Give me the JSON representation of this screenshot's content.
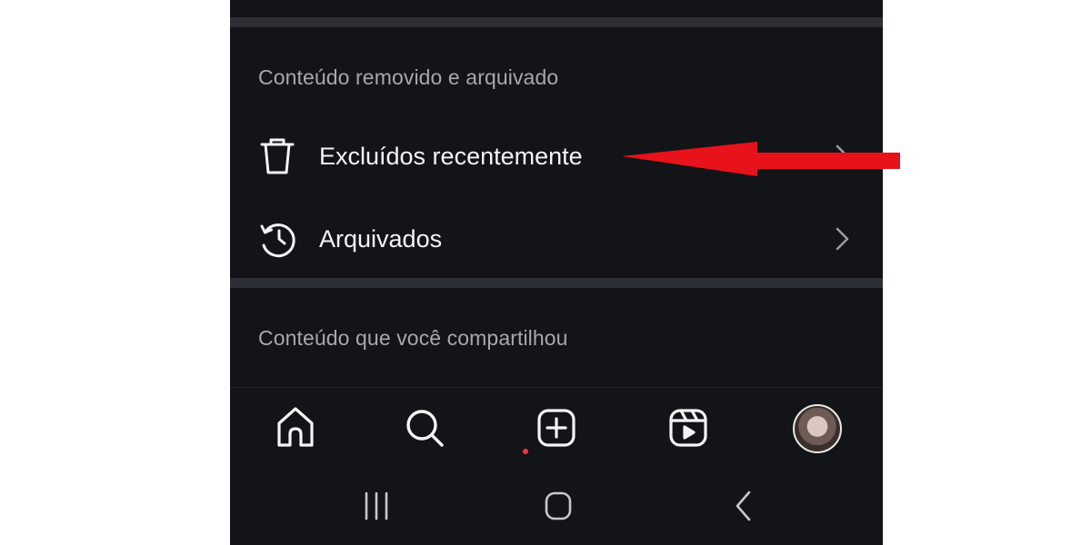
{
  "sections": {
    "removed_archived": {
      "title": "Conteúdo removido e arquivado"
    },
    "shared": {
      "title": "Conteúdo que você compartilhou"
    }
  },
  "menu": {
    "recently_deleted": {
      "label": "Excluídos recentemente",
      "icon": "trash-icon"
    },
    "archived": {
      "label": "Arquivados",
      "icon": "history-icon"
    }
  },
  "bottom_nav": {
    "items": [
      {
        "name": "home",
        "icon": "home-icon",
        "has_notification": true
      },
      {
        "name": "search",
        "icon": "search-icon"
      },
      {
        "name": "create",
        "icon": "plus-square-icon"
      },
      {
        "name": "reels",
        "icon": "reels-icon"
      },
      {
        "name": "profile",
        "icon": "avatar"
      }
    ]
  },
  "system_nav": [
    "recents-icon",
    "home-circle-icon",
    "back-icon"
  ],
  "colors": {
    "background": "#121418",
    "divider": "#2c2f35",
    "section_title": "#a6a8ad",
    "text": "#f4f4f5",
    "notification_dot": "#ff3040",
    "annotation_arrow": "#e8121a"
  }
}
